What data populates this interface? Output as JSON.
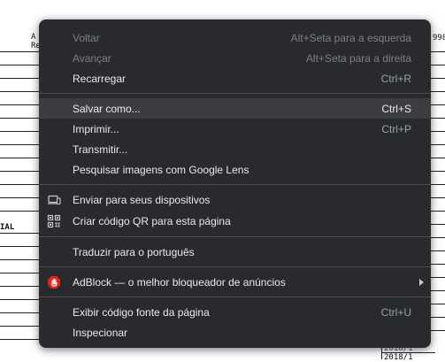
{
  "background": {
    "frag_top_left_1": "A",
    "frag_top_left_2": "Re",
    "frag_top_right": "998",
    "frag_left_mid": "IAL",
    "frag_bottom_1": "2018/1",
    "frag_bottom_2": "2018/1"
  },
  "menu": {
    "items": [
      {
        "label": "Voltar",
        "shortcut": "Alt+Seta para a esquerda"
      },
      {
        "label": "Avançar",
        "shortcut": "Alt+Seta para a direita"
      },
      {
        "label": "Recarregar",
        "shortcut": "Ctrl+R"
      },
      {
        "label": "Salvar como...",
        "shortcut": "Ctrl+S"
      },
      {
        "label": "Imprimir...",
        "shortcut": "Ctrl+P"
      },
      {
        "label": "Transmitir...",
        "shortcut": ""
      },
      {
        "label": "Pesquisar imagens com Google Lens",
        "shortcut": ""
      },
      {
        "label": "Enviar para seus dispositivos",
        "shortcut": "",
        "icon": "devices-icon"
      },
      {
        "label": "Criar código QR para esta página",
        "shortcut": "",
        "icon": "qr-code-icon"
      },
      {
        "label": "Traduzir para o português",
        "shortcut": ""
      },
      {
        "label": "AdBlock — o melhor bloqueador de anúncios",
        "shortcut": "",
        "icon": "adblock-hand-icon"
      },
      {
        "label": "Exibir código fonte da página",
        "shortcut": "Ctrl+U"
      },
      {
        "label": "Inspecionar",
        "shortcut": ""
      }
    ],
    "hovered_item": "Salvar como...",
    "colors": {
      "menu_bg": "#292a2d",
      "hover_bg": "#3c3d40",
      "text": "#e8eaed",
      "shortcut_text": "#9aa0a6",
      "disabled_text": "#7c7f84",
      "adblock_red": "#e2231a"
    }
  }
}
